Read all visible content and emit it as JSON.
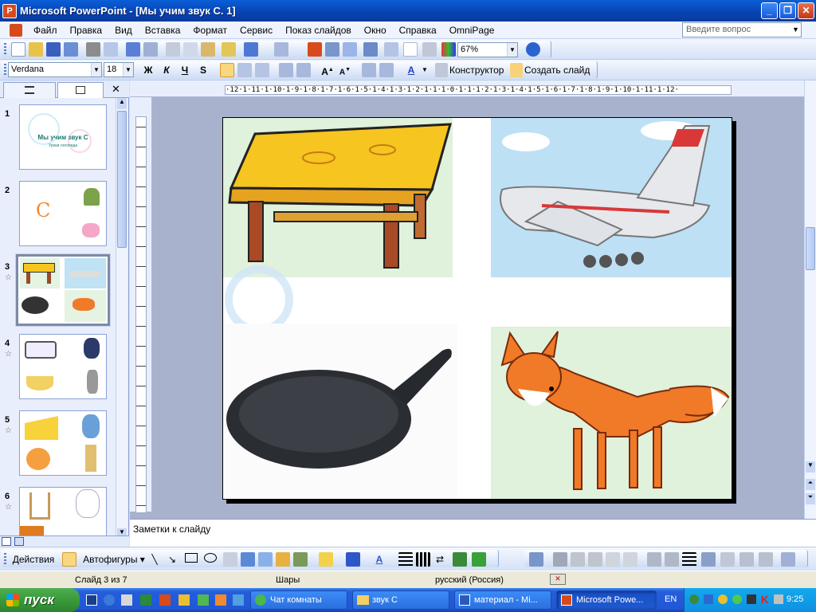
{
  "window": {
    "title": "Microsoft PowerPoint - [Мы учим звук С. 1]",
    "app_icon": "P"
  },
  "menu": {
    "items": [
      "Файл",
      "Правка",
      "Вид",
      "Вставка",
      "Формат",
      "Сервис",
      "Показ слайдов",
      "Окно",
      "Справка",
      "OmniPage"
    ],
    "help_placeholder": "Введите вопрос"
  },
  "standard_toolbar": {
    "zoom": "67%"
  },
  "formatting_toolbar": {
    "font": "Verdana",
    "size": "18",
    "bold": "Ж",
    "italic": "К",
    "underline": "Ч",
    "shadow": "S",
    "designer": "Конструктор",
    "new_slide": "Создать слайд"
  },
  "slide_panel": {
    "thumbnails": [
      {
        "num": "1",
        "title": "Мы учим звук С",
        "subtitle": "Уроки логопеда"
      },
      {
        "num": "2",
        "letter": "С"
      },
      {
        "num": "3",
        "selected": true
      },
      {
        "num": "4"
      },
      {
        "num": "5"
      },
      {
        "num": "6"
      }
    ]
  },
  "ruler": {
    "h_labels": "·12·1·11·1·10·1·9·1·8·1·7·1·6·1·5·1·4·1·3·1·2·1·1·1·0·1·1·1·2·1·3·1·4·1·5·1·6·1·7·1·8·1·9·1·10·1·11·1·12·"
  },
  "notes": {
    "placeholder": "Заметки к слайду"
  },
  "drawing_toolbar": {
    "actions": "Действия",
    "autoshapes": "Автофигуры"
  },
  "status": {
    "slide": "Слайд 3 из 7",
    "design": "Шары",
    "language": "русский (Россия)"
  },
  "taskbar": {
    "start": "пуск",
    "tasks": [
      {
        "label": "Чат комнаты"
      },
      {
        "label": "звук С"
      },
      {
        "label": "материал - Mi..."
      },
      {
        "label": "Microsoft Powe...",
        "active": true
      }
    ],
    "lang": "EN",
    "time": "9:25"
  },
  "colors": {
    "accent": "#0a5fd8",
    "taskbar": "#245edb",
    "start": "#3a9a3a"
  }
}
